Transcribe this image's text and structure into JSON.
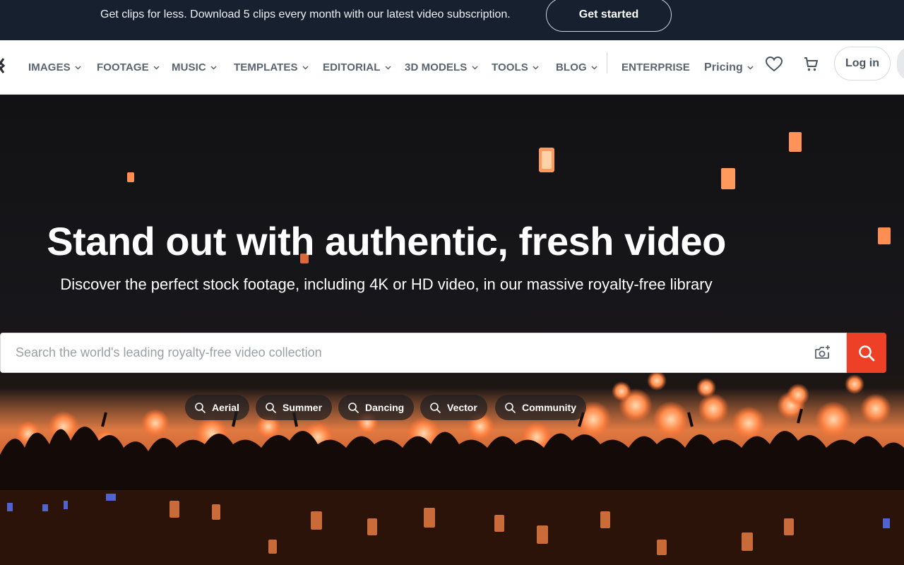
{
  "promo": {
    "text": "Get clips for less. Download 5 clips every month with our latest video subscription.",
    "cta_label": "Get started"
  },
  "nav": {
    "items": [
      {
        "label": "IMAGES",
        "has_dropdown": true
      },
      {
        "label": "FOOTAGE",
        "has_dropdown": true
      },
      {
        "label": "MUSIC",
        "has_dropdown": true
      },
      {
        "label": "TEMPLATES",
        "has_dropdown": true
      },
      {
        "label": "EDITORIAL",
        "has_dropdown": true
      },
      {
        "label": "3D MODELS",
        "has_dropdown": true
      },
      {
        "label": "TOOLS",
        "has_dropdown": true
      },
      {
        "label": "BLOG",
        "has_dropdown": true
      }
    ],
    "enterprise_label": "ENTERPRISE",
    "pricing_label": "Pricing",
    "icons": [
      "heart-icon",
      "cart-icon"
    ],
    "login_label": "Log in"
  },
  "hero": {
    "title": "Stand out with authentic, fresh video",
    "subtitle": "Discover the perfect stock footage, including 4K or HD video, in our massive royalty-free library",
    "search_placeholder": "Search the world's leading royalty-free video collection",
    "search_icons": [
      "camera-search-icon",
      "search-icon"
    ],
    "chips": [
      "Aerial",
      "Summer",
      "Dancing",
      "Vector",
      "Community"
    ]
  },
  "colors": {
    "promo_bg": "#16202e",
    "search_button": "#ee3f27",
    "nav_text": "#5a6470"
  }
}
